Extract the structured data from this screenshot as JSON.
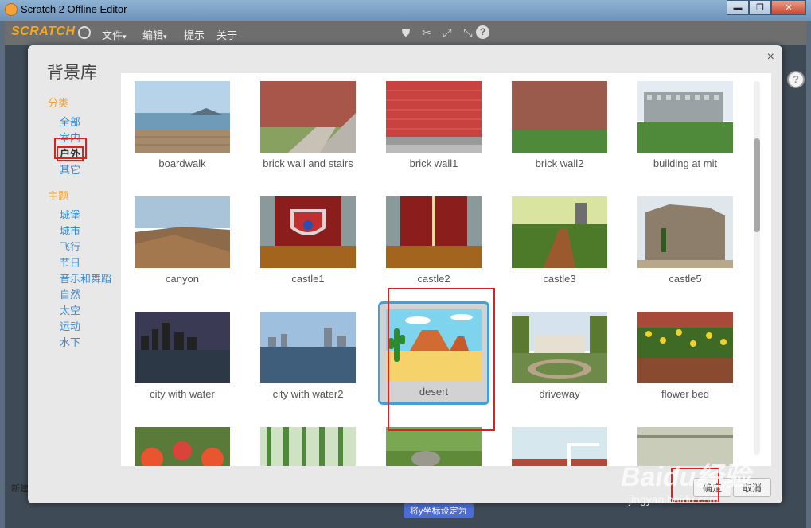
{
  "window": {
    "title": "Scratch 2 Offline Editor"
  },
  "menubar": {
    "logo": "SCRATCH",
    "items": [
      {
        "label": "文件"
      },
      {
        "label": "编辑"
      },
      {
        "label": "提示"
      },
      {
        "label": "关于"
      }
    ]
  },
  "dialog": {
    "title": "背景库",
    "close_label": "×",
    "category_heading": "分类",
    "categories": [
      {
        "label": "全部"
      },
      {
        "label": "室内"
      },
      {
        "label": "户外"
      },
      {
        "label": "其它"
      }
    ],
    "theme_heading": "主题",
    "themes": [
      {
        "label": "城堡"
      },
      {
        "label": "城市"
      },
      {
        "label": "飞行"
      },
      {
        "label": "节日"
      },
      {
        "label": "音乐和舞蹈"
      },
      {
        "label": "自然"
      },
      {
        "label": "太空"
      },
      {
        "label": "运动"
      },
      {
        "label": "水下"
      }
    ],
    "backdrops": [
      {
        "label": "boardwalk"
      },
      {
        "label": "brick wall and stairs"
      },
      {
        "label": "brick wall1"
      },
      {
        "label": "brick wall2"
      },
      {
        "label": "building at mit"
      },
      {
        "label": "canyon"
      },
      {
        "label": "castle1"
      },
      {
        "label": "castle2"
      },
      {
        "label": "castle3"
      },
      {
        "label": "castle5"
      },
      {
        "label": "city with water"
      },
      {
        "label": "city with water2"
      },
      {
        "label": "desert"
      },
      {
        "label": "driveway"
      },
      {
        "label": "flower bed"
      }
    ],
    "ok_label": "确定",
    "cancel_label": "取消"
  },
  "background": {
    "new_label": "新建",
    "block_label": "将y坐标设定为"
  },
  "watermark": {
    "main": "Baidu经验",
    "sub": "jingyan.baidu.com"
  }
}
